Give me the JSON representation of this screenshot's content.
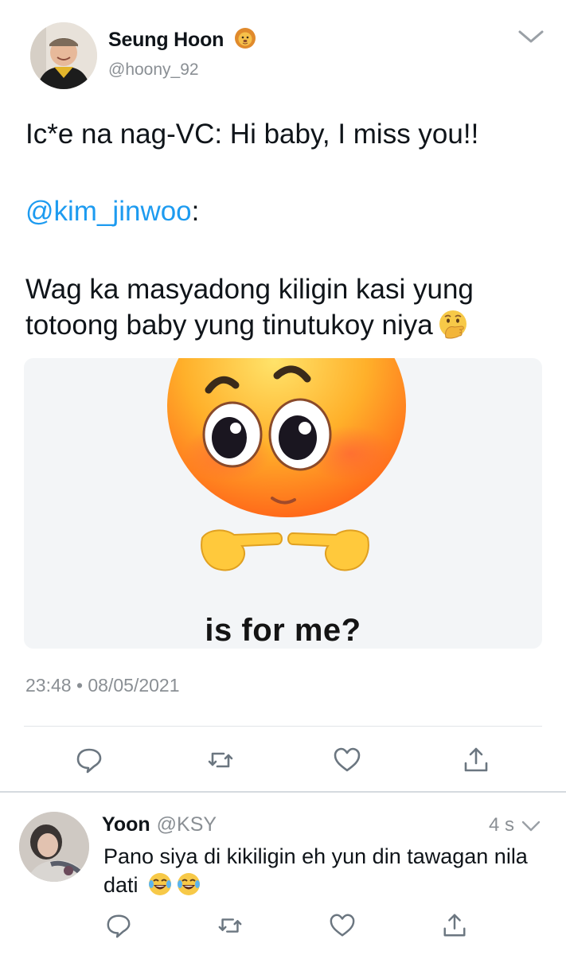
{
  "tweet": {
    "author": {
      "name": "Seung Hoon",
      "handle": "@hoony_92",
      "badge_icon": "lion-emoji"
    },
    "text_line1": "Ic*e na nag-VC: Hi baby, I miss you!!",
    "mention": "@kim_jinwoo",
    "mention_suffix": ":",
    "text_line3": "Wag ka masyadong kiligin kasi yung",
    "text_line4": "totoong baby yung tinutukoy niya",
    "inline_emoji": "hand-over-mouth-emoji",
    "media": {
      "caption": "is for me?",
      "image": "blushing-emoji-pointing-fingers"
    },
    "timestamp": "23:48 • 08/05/2021",
    "actions": [
      "reply-icon",
      "retweet-icon",
      "like-icon",
      "share-icon"
    ]
  },
  "reply": {
    "author": {
      "name": "Yoon",
      "handle": "@KSY"
    },
    "time": "4 s",
    "text": "Pano siya di kikiligin eh yun din tawagan nila dati",
    "emojis": [
      "tears-of-joy-emoji",
      "tears-of-joy-emoji"
    ],
    "actions": [
      "reply-icon",
      "retweet-icon",
      "like-icon",
      "share-icon"
    ]
  },
  "colors": {
    "link": "#1d9bf0",
    "muted": "#8a8f94",
    "divider": "#e1e5e8"
  }
}
